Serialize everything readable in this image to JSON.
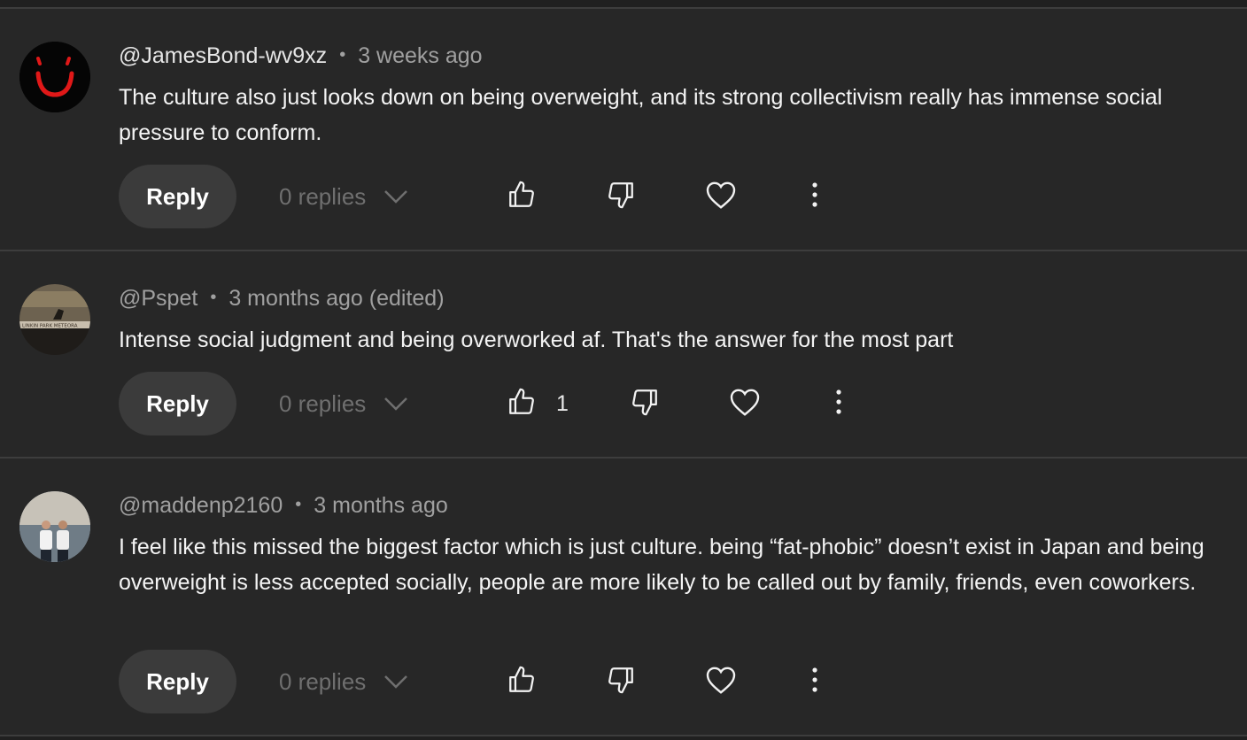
{
  "comments": [
    {
      "author": "@JamesBond-wv9xz",
      "time": "3 weeks ago",
      "text": "The culture also just looks down on being overweight, and its strong collectivism really has immense social pressure to conform.",
      "reply_label": "Reply",
      "replies_label": "0 replies",
      "like_count": "",
      "avatar_icon": "smiley-face-avatar"
    },
    {
      "author": "@Pspet",
      "time": "3 months ago (edited)",
      "text": "Intense social judgment and being overworked af. That's the answer for the most part",
      "reply_label": "Reply",
      "replies_label": "0 replies",
      "like_count": "1",
      "avatar_icon": "album-cover-avatar",
      "avatar_text": "LINKIN PARK METEORA"
    },
    {
      "author": "@maddenp2160",
      "time": "3 months ago",
      "text": "I feel like this missed the biggest factor which is just culture. being “fat-phobic” doesn’t exist in Japan  and being overweight is less accepted socially, people are more likely to be called out by family, friends, even coworkers.",
      "reply_label": "Reply",
      "replies_label": "0 replies",
      "like_count": "",
      "avatar_icon": "photo-avatar"
    }
  ],
  "colors": {
    "background": "#272727",
    "divider": "#3d3d3d",
    "meta_text": "#a0a0a0",
    "body_text": "#f4f4f4",
    "reply_button": "#3b3b3b",
    "replies_text": "#6f6f6f"
  },
  "icons": [
    "thumbs-up-icon",
    "thumbs-down-icon",
    "heart-icon",
    "more-vertical-icon",
    "chevron-down-icon"
  ]
}
